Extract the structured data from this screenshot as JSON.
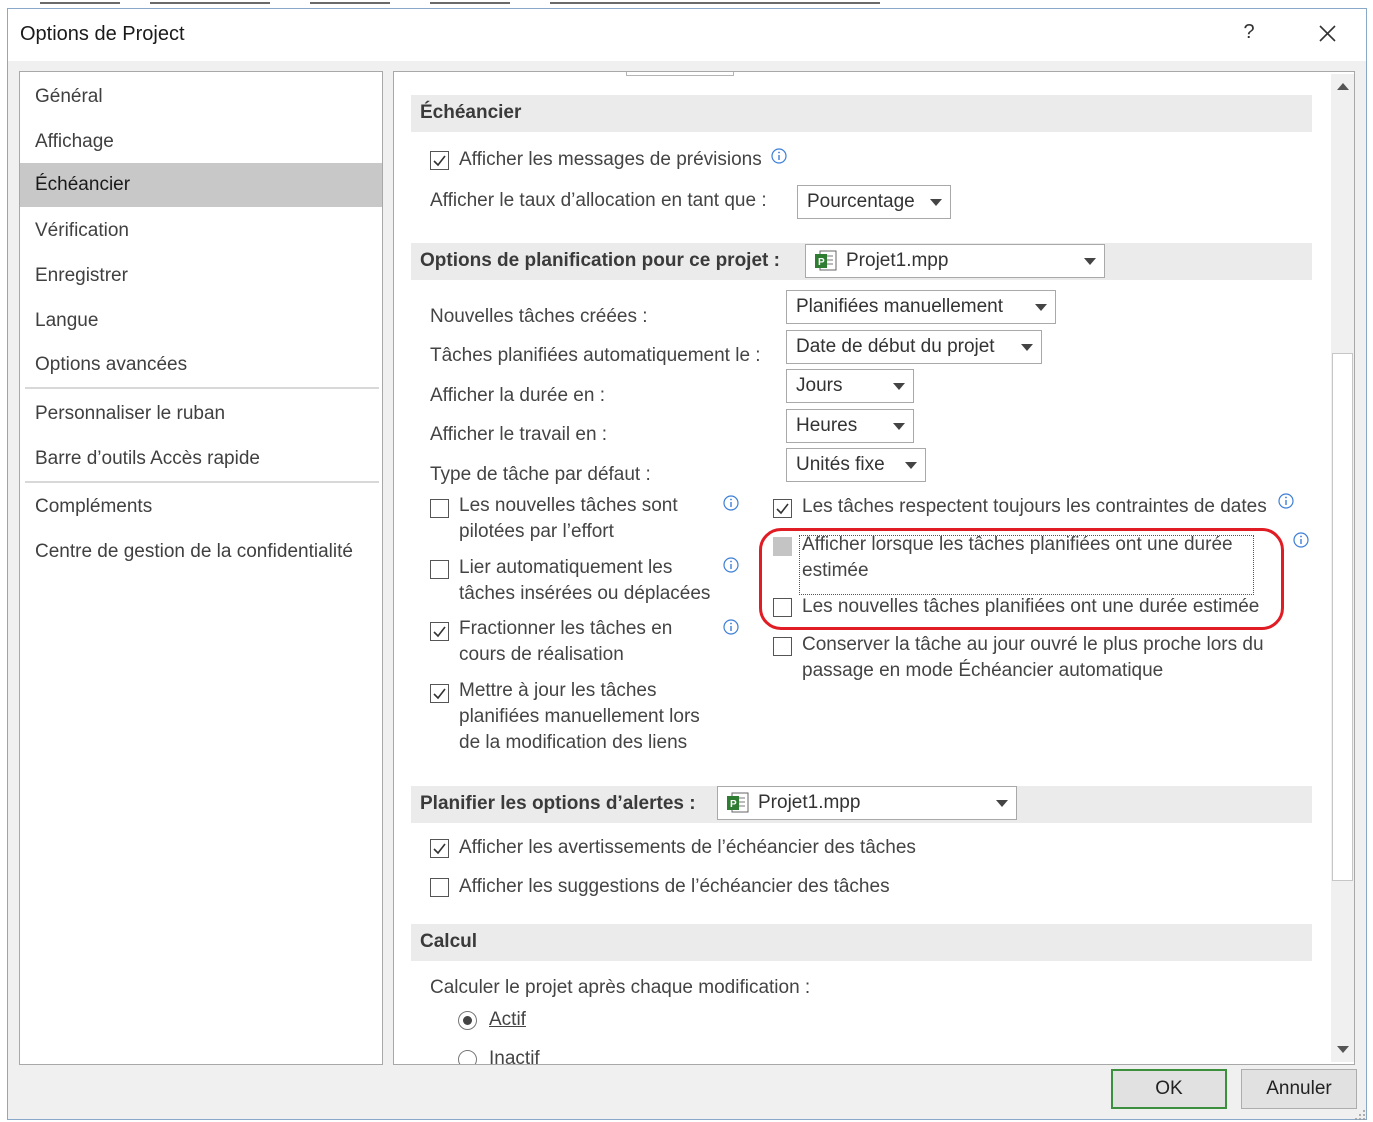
{
  "window": {
    "title": "Options de Project",
    "help_label": "?",
    "close_label": "✕"
  },
  "sidebar": {
    "items": [
      {
        "label": "Général"
      },
      {
        "label": "Affichage"
      },
      {
        "label": "Échéancier",
        "selected": true
      },
      {
        "label": "Vérification"
      },
      {
        "label": "Enregistrer"
      },
      {
        "label": "Langue"
      },
      {
        "label": "Options avancées"
      },
      {
        "label": "Personnaliser le ruban"
      },
      {
        "label": "Barre d’outils Accès rapide"
      },
      {
        "label": "Compléments"
      },
      {
        "label": "Centre de gestion de la confidentialité"
      }
    ]
  },
  "schedule": {
    "header": "Échéancier",
    "show_messages": {
      "label": "Afficher les messages de prévisions",
      "checked": true
    },
    "allocation": {
      "label": "Afficher le taux d’allocation en tant que :",
      "value": "Pourcentage"
    }
  },
  "planning": {
    "header": "Options de planification pour ce projet :",
    "project": "Projet1.mpp",
    "new_tasks": {
      "label": "Nouvelles tâches créées :",
      "value": "Planifiées manuellement"
    },
    "auto_tasks": {
      "label": "Tâches planifiées automatiquement le :",
      "value": "Date de début du projet"
    },
    "duration": {
      "label": "Afficher la durée en :",
      "value": "Jours"
    },
    "work": {
      "label": "Afficher le travail en :",
      "value": "Heures"
    },
    "task_type": {
      "label": "Type de tâche par défaut :",
      "value": "Unités fixe"
    },
    "effort_driven": {
      "label": "Les nouvelles tâches sont pilotées par l’effort",
      "checked": false
    },
    "autolink": {
      "label": "Lier automatiquement les tâches insérées ou déplacées",
      "checked": false
    },
    "split": {
      "label": "Fractionner les tâches en cours de réalisation",
      "checked": true
    },
    "update_manual": {
      "label": "Mettre à jour les tâches planifiées manuellement lors de la modification des liens",
      "checked": true
    },
    "honor_constraints": {
      "label": "Les tâches respectent toujours les contraintes de dates",
      "checked": true
    },
    "show_estimated": {
      "label": "Afficher lorsque les tâches planifiées ont une durée estimée",
      "checked": false,
      "disabled": true
    },
    "new_estimated": {
      "label": "Les nouvelles tâches planifiées ont une durée estimée",
      "checked": false
    },
    "keep_workday": {
      "label": "Conserver la tâche au jour ouvré le plus proche lors du passage en mode Échéancier automatique",
      "checked": false
    }
  },
  "alerts": {
    "header": "Planifier les options d’alertes :",
    "project": "Projet1.mpp",
    "warnings": {
      "label": "Afficher les avertissements de l’échéancier des tâches",
      "checked": true
    },
    "suggestions": {
      "label": "Afficher les suggestions de l’échéancier des tâches",
      "checked": false
    }
  },
  "calc": {
    "header": "Calcul",
    "label": "Calculer le projet après chaque modification :",
    "on": "Actif",
    "off": "Inactif",
    "selected": "Actif"
  },
  "footer": {
    "ok_label": "OK",
    "cancel_label": "Annuler"
  },
  "colors": {
    "highlight": "#e01c24",
    "ok_border": "#3c8f3c",
    "selected_nav": "#c8c8c8",
    "section_bg": "#ebebeb"
  }
}
